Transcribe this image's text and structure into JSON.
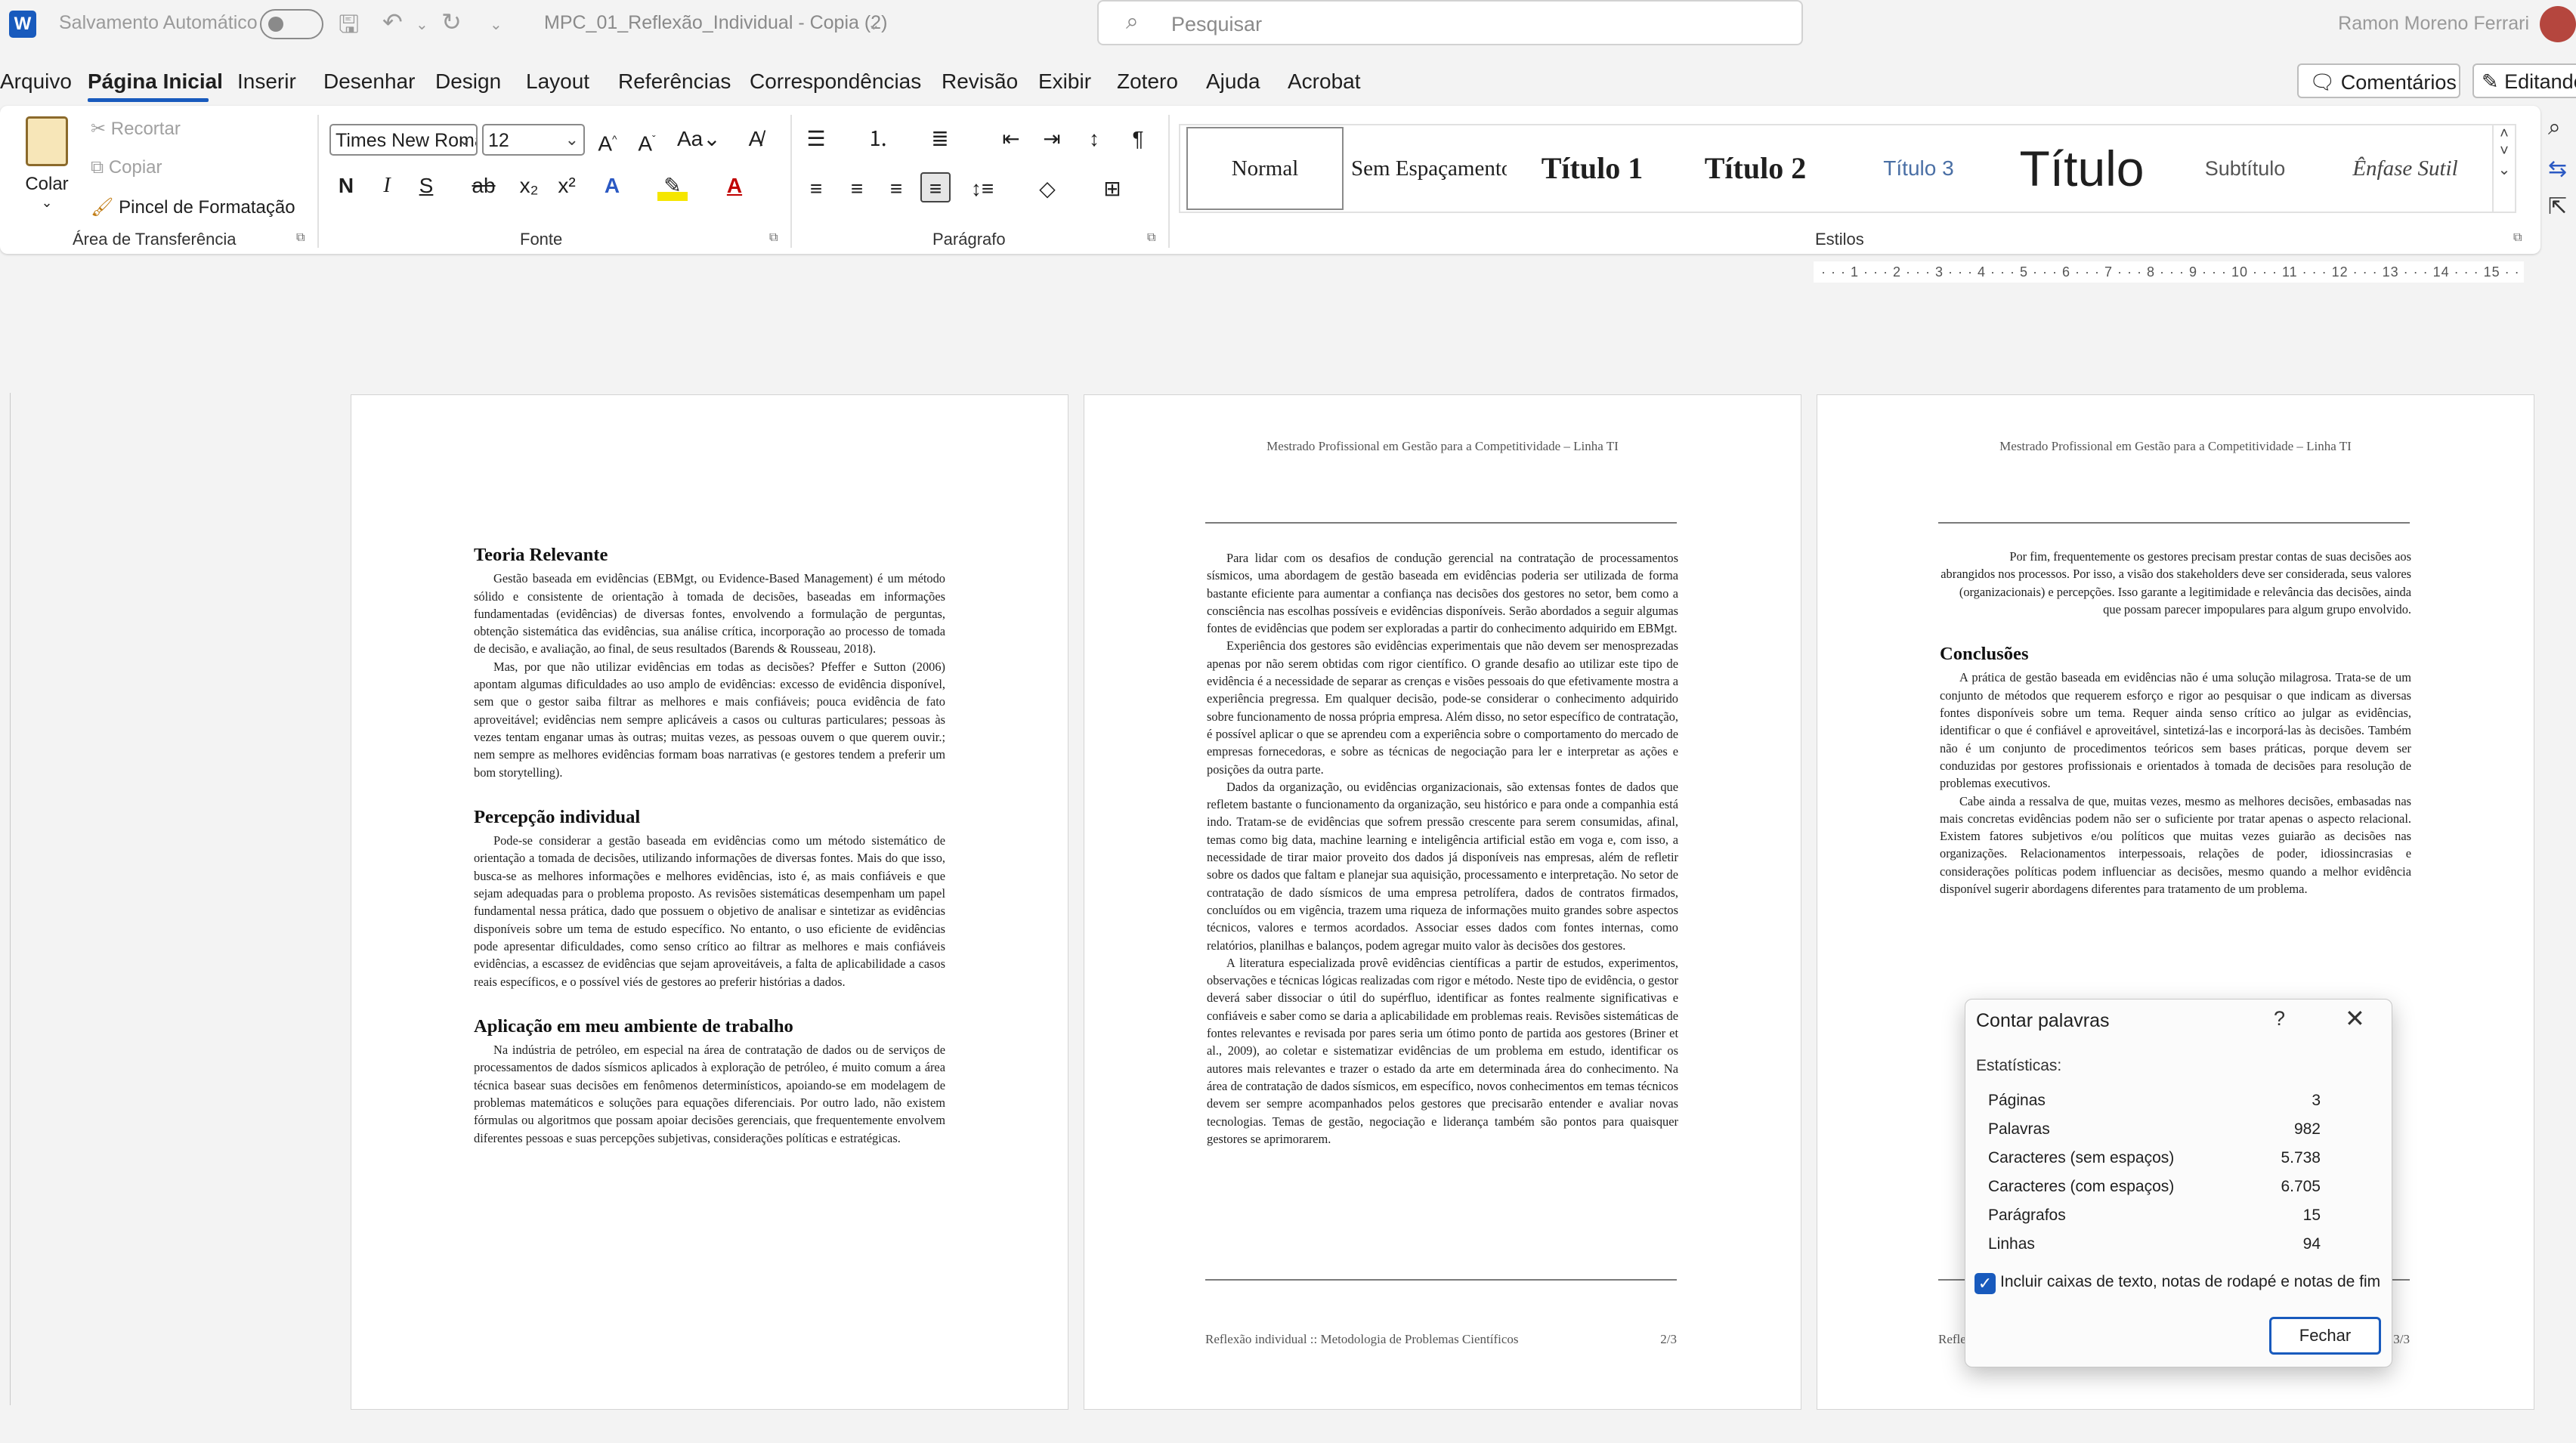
{
  "titlebar": {
    "app_icon": "W",
    "autosave": "Salvamento Automático",
    "doc_name": "MPC_01_Reflexão_Individual - Copia (2)",
    "search_placeholder": "Pesquisar",
    "user": "Ramon Moreno Ferrari"
  },
  "menu": {
    "items": [
      "Arquivo",
      "Página Inicial",
      "Inserir",
      "Desenhar",
      "Design",
      "Layout",
      "Referências",
      "Correspondências",
      "Revisão",
      "Exibir",
      "Zotero",
      "Ajuda",
      "Acrobat"
    ],
    "comments": "Comentários",
    "editing": "Editando"
  },
  "ribbon": {
    "clipboard": {
      "paste": "Colar",
      "cut": "Recortar",
      "copy": "Copiar",
      "format_painter": "Pincel de Formatação",
      "label": "Área de Transferência"
    },
    "font": {
      "name": "Times New Roman",
      "size": "12",
      "bold": "N",
      "italic": "I",
      "underline": "S",
      "strike": "ab",
      "label": "Fonte"
    },
    "paragraph": {
      "label": "Parágrafo"
    },
    "styles": {
      "items": [
        "Normal",
        "Sem Espaçamento",
        "Título 1",
        "Título 2",
        "Título 3",
        "Título",
        "Subtítulo",
        "Ênfase Sutil"
      ],
      "label": "Estilos"
    }
  },
  "ruler": "· · · 1 · · · 2 · · · 3 · · · 4 · · · 5 · · · 6 · · · 7 · · · 8 · · · 9 · · · 10 · · · 11 · · · 12 · · · 13 · · · 14 · · · 15 · ·",
  "header_text": "Mestrado Profissional em Gestão para a Competitividade – Linha TI",
  "page1": {
    "h1": "Teoria Relevante",
    "p1": "Gestão baseada em evidências (EBMgt, ou Evidence-Based Management) é um método sólido e consistente de orientação à tomada de decisões, baseadas em informações fundamentadas (evidências) de diversas fontes, envolvendo a formulação de perguntas, obtenção sistemática das evidências, sua análise crítica, incorporação ao processo de tomada de decisão, e avaliação, ao final, de seus resultados (Barends & Rousseau, 2018).",
    "p2": "Mas, por que não utilizar evidências em todas as decisões? Pfeffer e Sutton (2006) apontam algumas dificuldades ao uso amplo de evidências: excesso de evidência disponível, sem que o gestor saiba filtrar as melhores e mais confiáveis; pouca evidência de fato aproveitável; evidências nem sempre aplicáveis a casos ou culturas particulares; pessoas às vezes tentam enganar umas às outras; muitas vezes, as pessoas ouvem o que querem ouvir.; nem sempre as melhores evidências formam boas narrativas (e gestores tendem a preferir um bom storytelling).",
    "h2": "Percepção individual",
    "p3": "Pode-se considerar a gestão baseada em evidências como um método sistemático de orientação a tomada de decisões, utilizando informações de diversas fontes. Mais do que isso, busca-se as melhores informações e melhores evidências, isto é, as mais confiáveis e que sejam adequadas para o problema proposto. As revisões sistemáticas desempenham um papel fundamental nessa prática, dado que possuem o objetivo de analisar e sintetizar as evidências disponíveis sobre um tema de estudo específico. No entanto, o uso eficiente de evidências pode apresentar dificuldades, como senso crítico ao filtrar as melhores e mais confiáveis evidências, a escassez de evidências que sejam aproveitáveis, a falta de aplicabilidade a casos reais específicos, e o possível viés de gestores ao preferir histórias a dados.",
    "h3": "Aplicação em meu ambiente de trabalho",
    "p4": "Na indústria de petróleo, em especial na área de contratação de dados ou de serviços de processamentos de dados sísmicos aplicados à exploração de petróleo, é muito comum a área técnica basear suas decisões em fenômenos determinísticos, apoiando-se em modelagem de problemas matemáticos e soluções para equações diferenciais. Por outro lado, não existem fórmulas ou algoritmos que possam apoiar decisões gerenciais, que frequentemente envolvem diferentes pessoas e suas percepções subjetivas, considerações políticas e estratégicas."
  },
  "page2": {
    "p1": "Para lidar com os desafios de condução gerencial na contratação de processamentos sísmicos, uma abordagem de gestão baseada em evidências poderia ser utilizada de forma bastante eficiente para aumentar a confiança nas decisões dos gestores no setor, bem como a consciência nas escolhas possíveis e evidências disponíveis. Serão abordados a seguir algumas fontes de evidências que podem ser exploradas a partir do conhecimento adquirido em EBMgt.",
    "p2": "Experiência dos gestores são evidências experimentais que não devem ser menosprezadas apenas por não serem obtidas com rigor científico. O grande desafio ao utilizar este tipo de evidência é a necessidade de separar as crenças e visões pessoais do que efetivamente mostra a experiência pregressa. Em qualquer decisão, pode-se considerar o conhecimento adquirido sobre funcionamento de nossa própria empresa. Além disso, no setor específico de contratação, é possível aplicar o que se aprendeu com a experiência sobre o comportamento do mercado de empresas fornecedoras, e sobre as técnicas de negociação para ler e interpretar as ações e posições da outra parte.",
    "p3": "Dados da organização, ou evidências organizacionais, são extensas fontes de dados que refletem bastante o funcionamento da organização, seu histórico e para onde a companhia está indo. Tratam-se de evidências que sofrem pressão crescente para serem consumidas, afinal, temas como big data, machine learning e inteligência artificial estão em voga e, com isso, a necessidade de tirar maior proveito dos dados já disponíveis nas empresas, além de refletir sobre os dados que faltam e planejar sua aquisição, processamento e interpretação. No setor de contratação de dado sísmicos de uma empresa petrolífera, dados de contratos firmados, concluídos ou em vigência, trazem uma riqueza de informações muito grandes sobre aspectos técnicos, valores e termos acordados. Associar esses dados com fontes internas, como relatórios, planilhas e balanços, podem agregar muito valor às decisões dos gestores.",
    "p4": "A literatura especializada provê evidências científicas a partir de estudos, experimentos, observações e técnicas lógicas realizadas com rigor e método. Neste tipo de evidência, o gestor deverá saber dissociar o útil do supérfluo, identificar as fontes realmente significativas e confiáveis e saber como se daria a aplicabilidade em problemas reais. Revisões sistemáticas de fontes relevantes e revisada por pares seria um ótimo ponto de partida aos gestores (Briner et al., 2009), ao coletar e sistematizar evidências de um problema em estudo, identificar os autores mais relevantes e trazer o estado da arte em determinada área do conhecimento. Na área de contratação de dados sísmicos, em específico, novos conhecimentos em temas técnicos devem ser sempre acompanhados pelos gestores que precisarão entender e avaliar novas tecnologias. Temas de gestão, negociação e liderança também são pontos para quaisquer gestores se aprimorarem.",
    "footer": "Reflexão individual :: Metodologia de Problemas Científicos",
    "pagenum": "2/3"
  },
  "page3": {
    "p1": "Por fim, frequentemente os gestores precisam prestar contas de suas decisões aos abrangidos nos processos. Por isso, a visão dos stakeholders deve ser considerada, seus valores (organizacionais) e percepções. Isso garante a legitimidade e relevância das decisões, ainda que possam parecer impopulares para algum grupo envolvido.",
    "h1": "Conclusões",
    "p2": "A prática de gestão baseada em evidências não é uma solução milagrosa. Trata-se de um conjunto de métodos que requerem esforço e rigor ao pesquisar o que indicam as diversas fontes disponíveis sobre um tema. Requer ainda senso crítico ao julgar as evidências, identificar o que é confiável e aproveitável, sintetizá-las e incorporá-las às decisões. Também não é um conjunto de procedimentos teóricos sem bases práticas, porque devem ser conduzidas por gestores profissionais e orientados à tomada de decisões para resolução de problemas executivos.",
    "p3": "Cabe ainda a ressalva de que, muitas vezes, mesmo as melhores decisões, embasadas nas mais concretas evidências podem não ser o suficiente por tratar apenas o aspecto relacional. Existem fatores subjetivos e/ou políticos que muitas vezes guiarão as decisões nas organizações. Relacionamentos interpessoais, relações de poder, idiossincrasias e considerações políticas podem influenciar as decisões, mesmo quando a melhor evidência disponível sugerir abordagens diferentes para tratamento de um problema.",
    "footer": "Refle",
    "pagenum": "3/3"
  },
  "dialog": {
    "title": "Contar palavras",
    "help": "?",
    "close": "✕",
    "stats_label": "Estatísticas:",
    "rows": [
      {
        "label": "Páginas",
        "value": "3"
      },
      {
        "label": "Palavras",
        "value": "982"
      },
      {
        "label": "Caracteres (sem espaços)",
        "value": "5.738"
      },
      {
        "label": "Caracteres (com espaços)",
        "value": "6.705"
      },
      {
        "label": "Parágrafos",
        "value": "15"
      },
      {
        "label": "Linhas",
        "value": "94"
      }
    ],
    "checkbox_label": "Incluir caixas de texto, notas de rodapé e notas de fim",
    "close_button": "Fechar"
  }
}
